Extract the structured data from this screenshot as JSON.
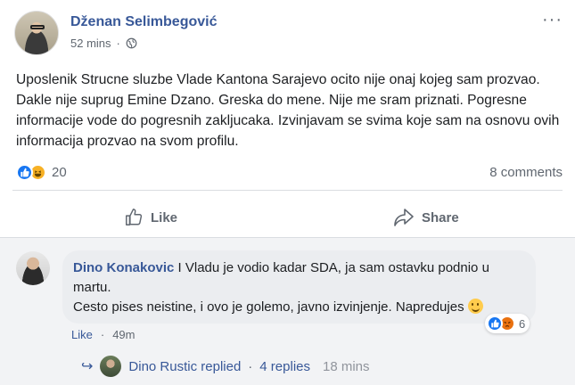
{
  "post": {
    "author": "Dženan Selimbegović",
    "time": "52 mins",
    "privacy_icon": "globe-icon",
    "text": "Uposlenik Strucne sluzbe Vlade Kantona Sarajevo ocito nije onaj kojeg sam prozvao. Dakle nije suprug Emine Dzano. Greska do mene. Nije me sram priznati. Pogresne informacije vode do pogresnih zakljucaka. Izvinjavam se svima koje sam na osnovu ovih informacija prozvao na svom profilu.",
    "reaction_count": "20",
    "comments_count": "8 comments"
  },
  "actions": {
    "like": "Like",
    "share": "Share"
  },
  "comment": {
    "author": "Dino Konakovic",
    "separator": "I",
    "text_line1": "Vladu je vodio kadar SDA, ja sam ostavku podnio u martu.",
    "text_line2": "Cesto pises neistine, i ovo je golemo, javno izvinjenje. Napredujes",
    "reaction_count": "6",
    "like_label": "Like",
    "dot": "·",
    "time": "49m"
  },
  "replies": {
    "arrow": "↪",
    "name": "Dino Rustic replied",
    "dot": "·",
    "count": "4 replies",
    "time": "18 mins"
  },
  "colors": {
    "link_blue": "#385898",
    "like_blue": "#1877f2",
    "haha_yellow": "#f7b125",
    "angry_orange": "#e9710f"
  }
}
